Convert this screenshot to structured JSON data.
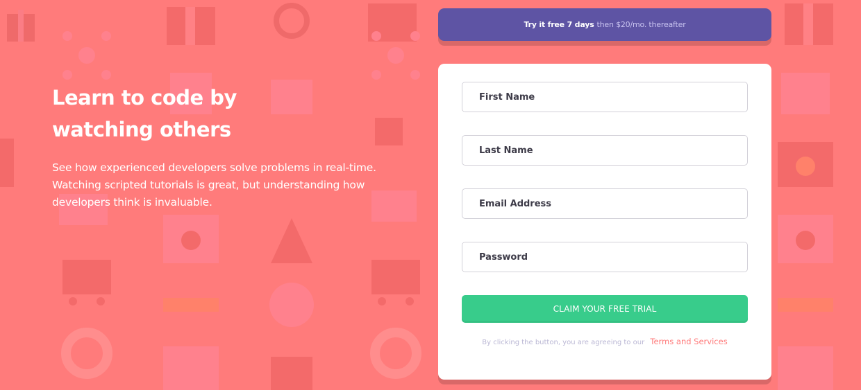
{
  "colors": {
    "background": "#ff7b7b",
    "banner": "#5e54a4",
    "button": "#38cc8b",
    "terms_link": "#ff7a7a"
  },
  "hero": {
    "title": "Learn to code by watching others",
    "description": "See how experienced developers solve problems in real-time. Watching scripted tutorials is great, but understanding how developers think is invaluable."
  },
  "banner": {
    "strong_text": "Try it free 7 days",
    "light_text": "then $20/mo. thereafter"
  },
  "form": {
    "first_name_placeholder": "First Name",
    "last_name_placeholder": "Last Name",
    "email_placeholder": "Email Address",
    "password_placeholder": "Password",
    "submit_label": "CLAIM YOUR FREE TRIAL",
    "terms_text": "By clicking the button, you are agreeing to our",
    "terms_link": "Terms and Services"
  }
}
